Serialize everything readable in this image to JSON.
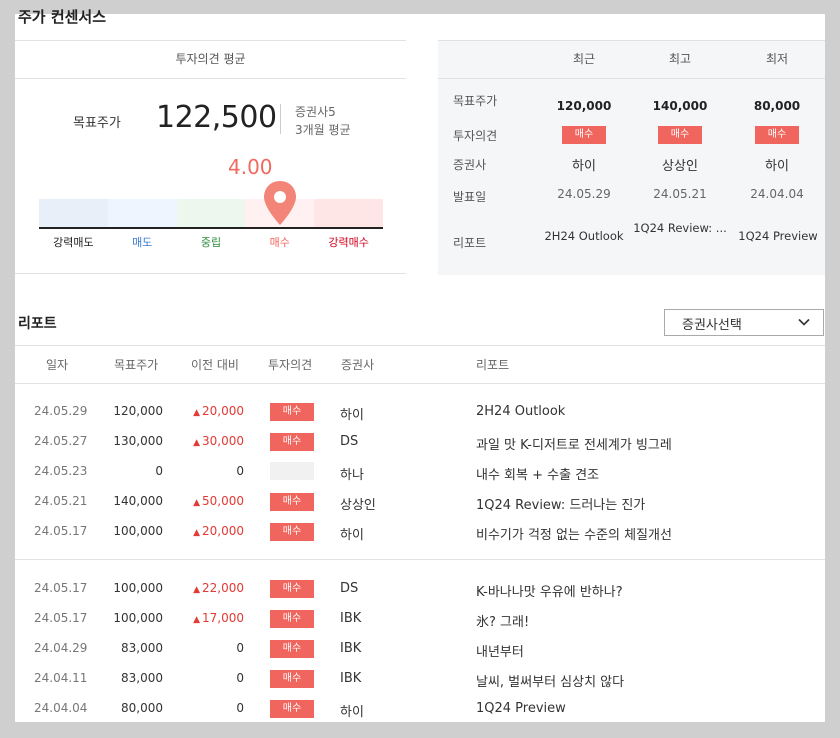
{
  "title": "주가 컨센서스",
  "summary": {
    "header": "투자의견 평균",
    "target_label": "목표주가",
    "target_value": "122,500",
    "brokers": "증권사5",
    "period": "3개월 평균",
    "score": "4.00",
    "score_value": 4.0,
    "scale": [
      "강력매도",
      "매도",
      "중립",
      "매수",
      "강력매수"
    ],
    "scale_colors": [
      "#222222",
      "#3a7bd5",
      "#2e8b3e",
      "#f0665f",
      "#d0021b"
    ],
    "band_colors": [
      "#e9eff9",
      "#eef5ff",
      "#eef7ee",
      "#fff1f1",
      "#ffe6e6"
    ]
  },
  "consensus": {
    "columns": [
      "최근",
      "최고",
      "최저"
    ],
    "row_labels": [
      "목표주가",
      "투자의견",
      "증권사",
      "발표일",
      "리포트"
    ],
    "target": [
      "120,000",
      "140,000",
      "80,000"
    ],
    "opinion": [
      "매수",
      "매수",
      "매수"
    ],
    "broker": [
      "하이",
      "상상인",
      "하이"
    ],
    "date": [
      "24.05.29",
      "24.05.21",
      "24.04.04"
    ],
    "report": [
      "2H24 Outlook",
      "1Q24 Review: ...",
      "1Q24 Preview"
    ]
  },
  "reports": {
    "title": "리포트",
    "filter_label": "증권사선택",
    "columns": [
      "일자",
      "목표주가",
      "이전 대비",
      "투자의견",
      "증권사",
      "리포트"
    ],
    "rows": [
      {
        "date": "24.05.29",
        "target": "120,000",
        "diff": "20,000",
        "up": true,
        "opinion": "매수",
        "broker": "하이",
        "report": "2H24 Outlook"
      },
      {
        "date": "24.05.27",
        "target": "130,000",
        "diff": "30,000",
        "up": true,
        "opinion": "매수",
        "broker": "DS",
        "report": "과일 맛 K-디저트로 전세계가 빙그레"
      },
      {
        "date": "24.05.23",
        "target": "0",
        "diff": "0",
        "up": false,
        "opinion": "",
        "broker": "하나",
        "report": "내수 회복 + 수출 견조"
      },
      {
        "date": "24.05.21",
        "target": "140,000",
        "diff": "50,000",
        "up": true,
        "opinion": "매수",
        "broker": "상상인",
        "report": "1Q24 Review: 드러나는 진가"
      },
      {
        "date": "24.05.17",
        "target": "100,000",
        "diff": "20,000",
        "up": true,
        "opinion": "매수",
        "broker": "하이",
        "report": "비수기가 걱정 없는 수준의 체질개선"
      },
      {
        "date": "24.05.17",
        "target": "100,000",
        "diff": "22,000",
        "up": true,
        "opinion": "매수",
        "broker": "DS",
        "report": "K-바나나맛 우유에 반하나?"
      },
      {
        "date": "24.05.17",
        "target": "100,000",
        "diff": "17,000",
        "up": true,
        "opinion": "매수",
        "broker": "IBK",
        "report": "氷? 그래!"
      },
      {
        "date": "24.04.29",
        "target": "83,000",
        "diff": "0",
        "up": false,
        "opinion": "매수",
        "broker": "IBK",
        "report": "내년부터"
      },
      {
        "date": "24.04.11",
        "target": "83,000",
        "diff": "0",
        "up": false,
        "opinion": "매수",
        "broker": "IBK",
        "report": "날씨, 벌써부터 심상치 않다"
      },
      {
        "date": "24.04.04",
        "target": "80,000",
        "diff": "0",
        "up": false,
        "opinion": "매수",
        "broker": "하이",
        "report": "1Q24 Preview"
      }
    ]
  }
}
